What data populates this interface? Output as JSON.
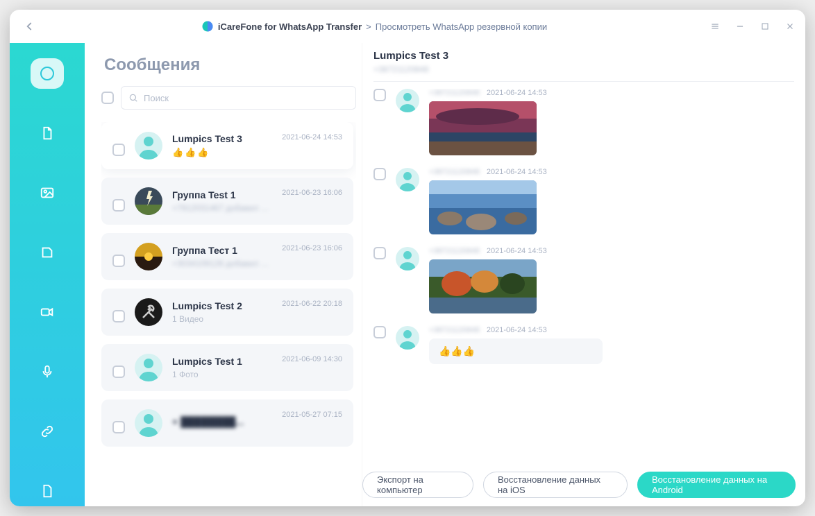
{
  "titlebar": {
    "app": "iCareFone for WhatsApp Transfer",
    "sep": ">",
    "crumb": "Просмотреть WhatsApp резервной копии"
  },
  "chatlist": {
    "title": "Сообщения",
    "search_placeholder": "Поиск",
    "chats": [
      {
        "name": "Lumpics Test 3",
        "sub": "👍👍👍",
        "time": "2021-06-24 14:53",
        "active": true,
        "avatar": "person",
        "thumbs": true
      },
      {
        "name": "Группа Test 1",
        "sub": "+7912031467 добавил +30946321716",
        "time": "2021-06-23 16:06",
        "avatar": "storm",
        "blur": true
      },
      {
        "name": "Группа Тест 1",
        "sub": "+3034109128 добавил +30946321716",
        "time": "2021-06-23 16:06",
        "avatar": "sunset",
        "blur": true
      },
      {
        "name": "Lumpics Test 2",
        "sub": "1 Видео",
        "time": "2021-06-22 20:18",
        "avatar": "tools"
      },
      {
        "name": "Lumpics Test 1",
        "sub": "1 Фото",
        "time": "2021-06-09 14:30",
        "avatar": "person"
      },
      {
        "name": "+ ████████...",
        "sub": "",
        "time": "2021-05-27 07:15",
        "avatar": "person",
        "blurname": true
      }
    ]
  },
  "conversation": {
    "name": "Lumpics Test 3",
    "number": "+38721120848",
    "messages": [
      {
        "number": "+38721120848",
        "time": "2021-06-24 14:53",
        "image": "beach"
      },
      {
        "number": "+38721120848",
        "time": "2021-06-24 14:53",
        "image": "rocks"
      },
      {
        "number": "+38721120848",
        "time": "2021-06-24 14:53",
        "image": "autumn"
      },
      {
        "number": "+38721120848",
        "time": "2021-06-24 14:53",
        "bubble": "👍👍👍"
      }
    ]
  },
  "actions": {
    "export": "Экспорт на компьютер",
    "restore_ios": "Восстановление данных на iOS",
    "restore_android": "Восстановление данных на Android"
  }
}
